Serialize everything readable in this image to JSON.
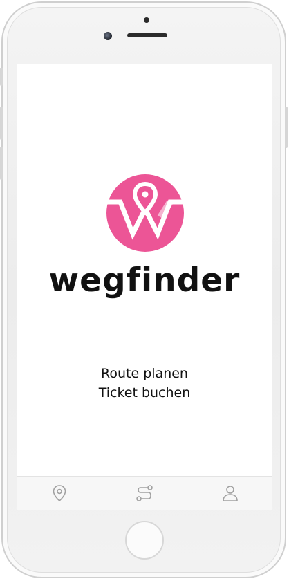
{
  "app": {
    "brand_name": "wegfinder",
    "brand_color": "#ec5596",
    "logo_icon": "wegfinder-w-pin-logo"
  },
  "taglines": [
    "Route planen",
    "Ticket buchen"
  ],
  "tabbar": {
    "items": [
      {
        "icon": "location-pin-icon"
      },
      {
        "icon": "route-icon"
      },
      {
        "icon": "user-icon"
      }
    ]
  },
  "device": {
    "type": "phone-frame",
    "frame_color": "#f0f0f0"
  }
}
